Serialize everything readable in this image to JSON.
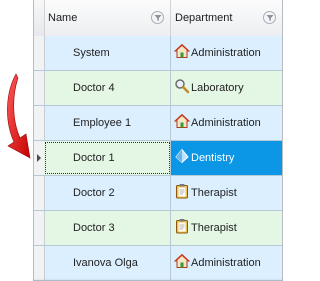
{
  "columns": {
    "name": "Name",
    "department": "Department"
  },
  "rows": [
    {
      "name": "System",
      "department": "Administration",
      "icon": "house-icon",
      "tint": "blue"
    },
    {
      "name": "Doctor 4",
      "department": "Laboratory",
      "icon": "magnifier-icon",
      "tint": "green"
    },
    {
      "name": "Employee 1",
      "department": "Administration",
      "icon": "house-icon",
      "tint": "blue"
    },
    {
      "name": "Doctor 1",
      "department": "Dentistry",
      "icon": "tooth-icon",
      "tint": "selected"
    },
    {
      "name": "Doctor 2",
      "department": "Therapist",
      "icon": "clipboard-icon",
      "tint": "blue"
    },
    {
      "name": "Doctor 3",
      "department": "Therapist",
      "icon": "clipboard-icon",
      "tint": "green"
    },
    {
      "name": "Ivanova Olga",
      "department": "Administration",
      "icon": "house-icon",
      "tint": "blue"
    }
  ],
  "colors": {
    "row_blue": "#dcefff",
    "row_green": "#e4f6e4",
    "selected": "#0b97e6",
    "arrow": "#e01b1b"
  }
}
